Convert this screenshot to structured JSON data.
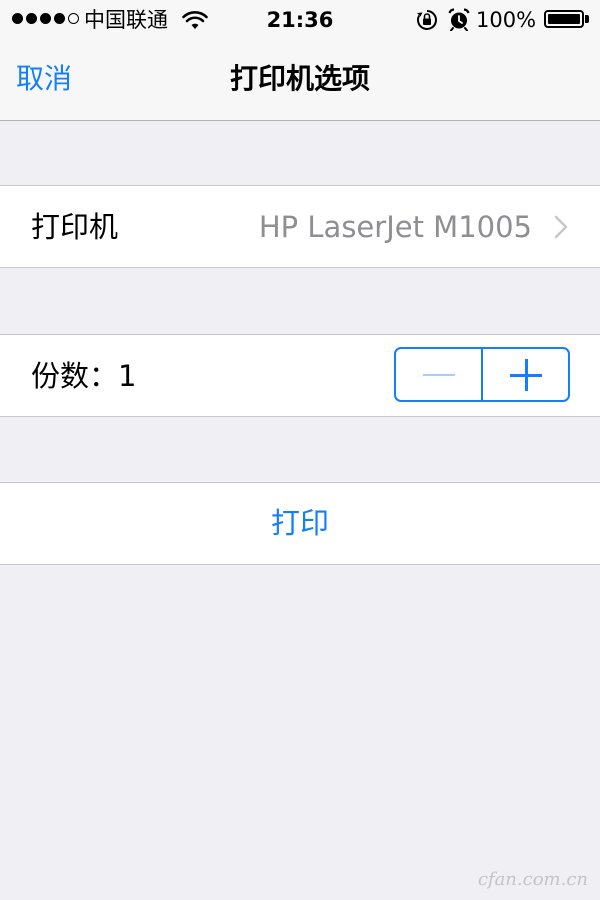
{
  "status_bar": {
    "signal_dots_filled": 4,
    "signal_dots_total": 5,
    "carrier": "中国联通",
    "time": "21:36",
    "battery_percent": "100%",
    "battery_level": 1.0,
    "icons": [
      "wifi-icon",
      "rotation-lock-icon",
      "alarm-icon",
      "battery-icon"
    ]
  },
  "nav": {
    "cancel_label": "取消",
    "title": "打印机选项"
  },
  "printer_cell": {
    "label": "打印机",
    "value": "HP LaserJet M1005"
  },
  "copies_cell": {
    "label": "份数：1",
    "count": 1
  },
  "print_cell": {
    "label": "打印"
  },
  "watermark": "cfan.com.cn",
  "colors": {
    "accent": "#157efb",
    "background": "#efeff4",
    "nav_background": "#f7f7f7",
    "secondary_text": "#8e8e93",
    "disabled_accent": "#a6cdfb"
  }
}
